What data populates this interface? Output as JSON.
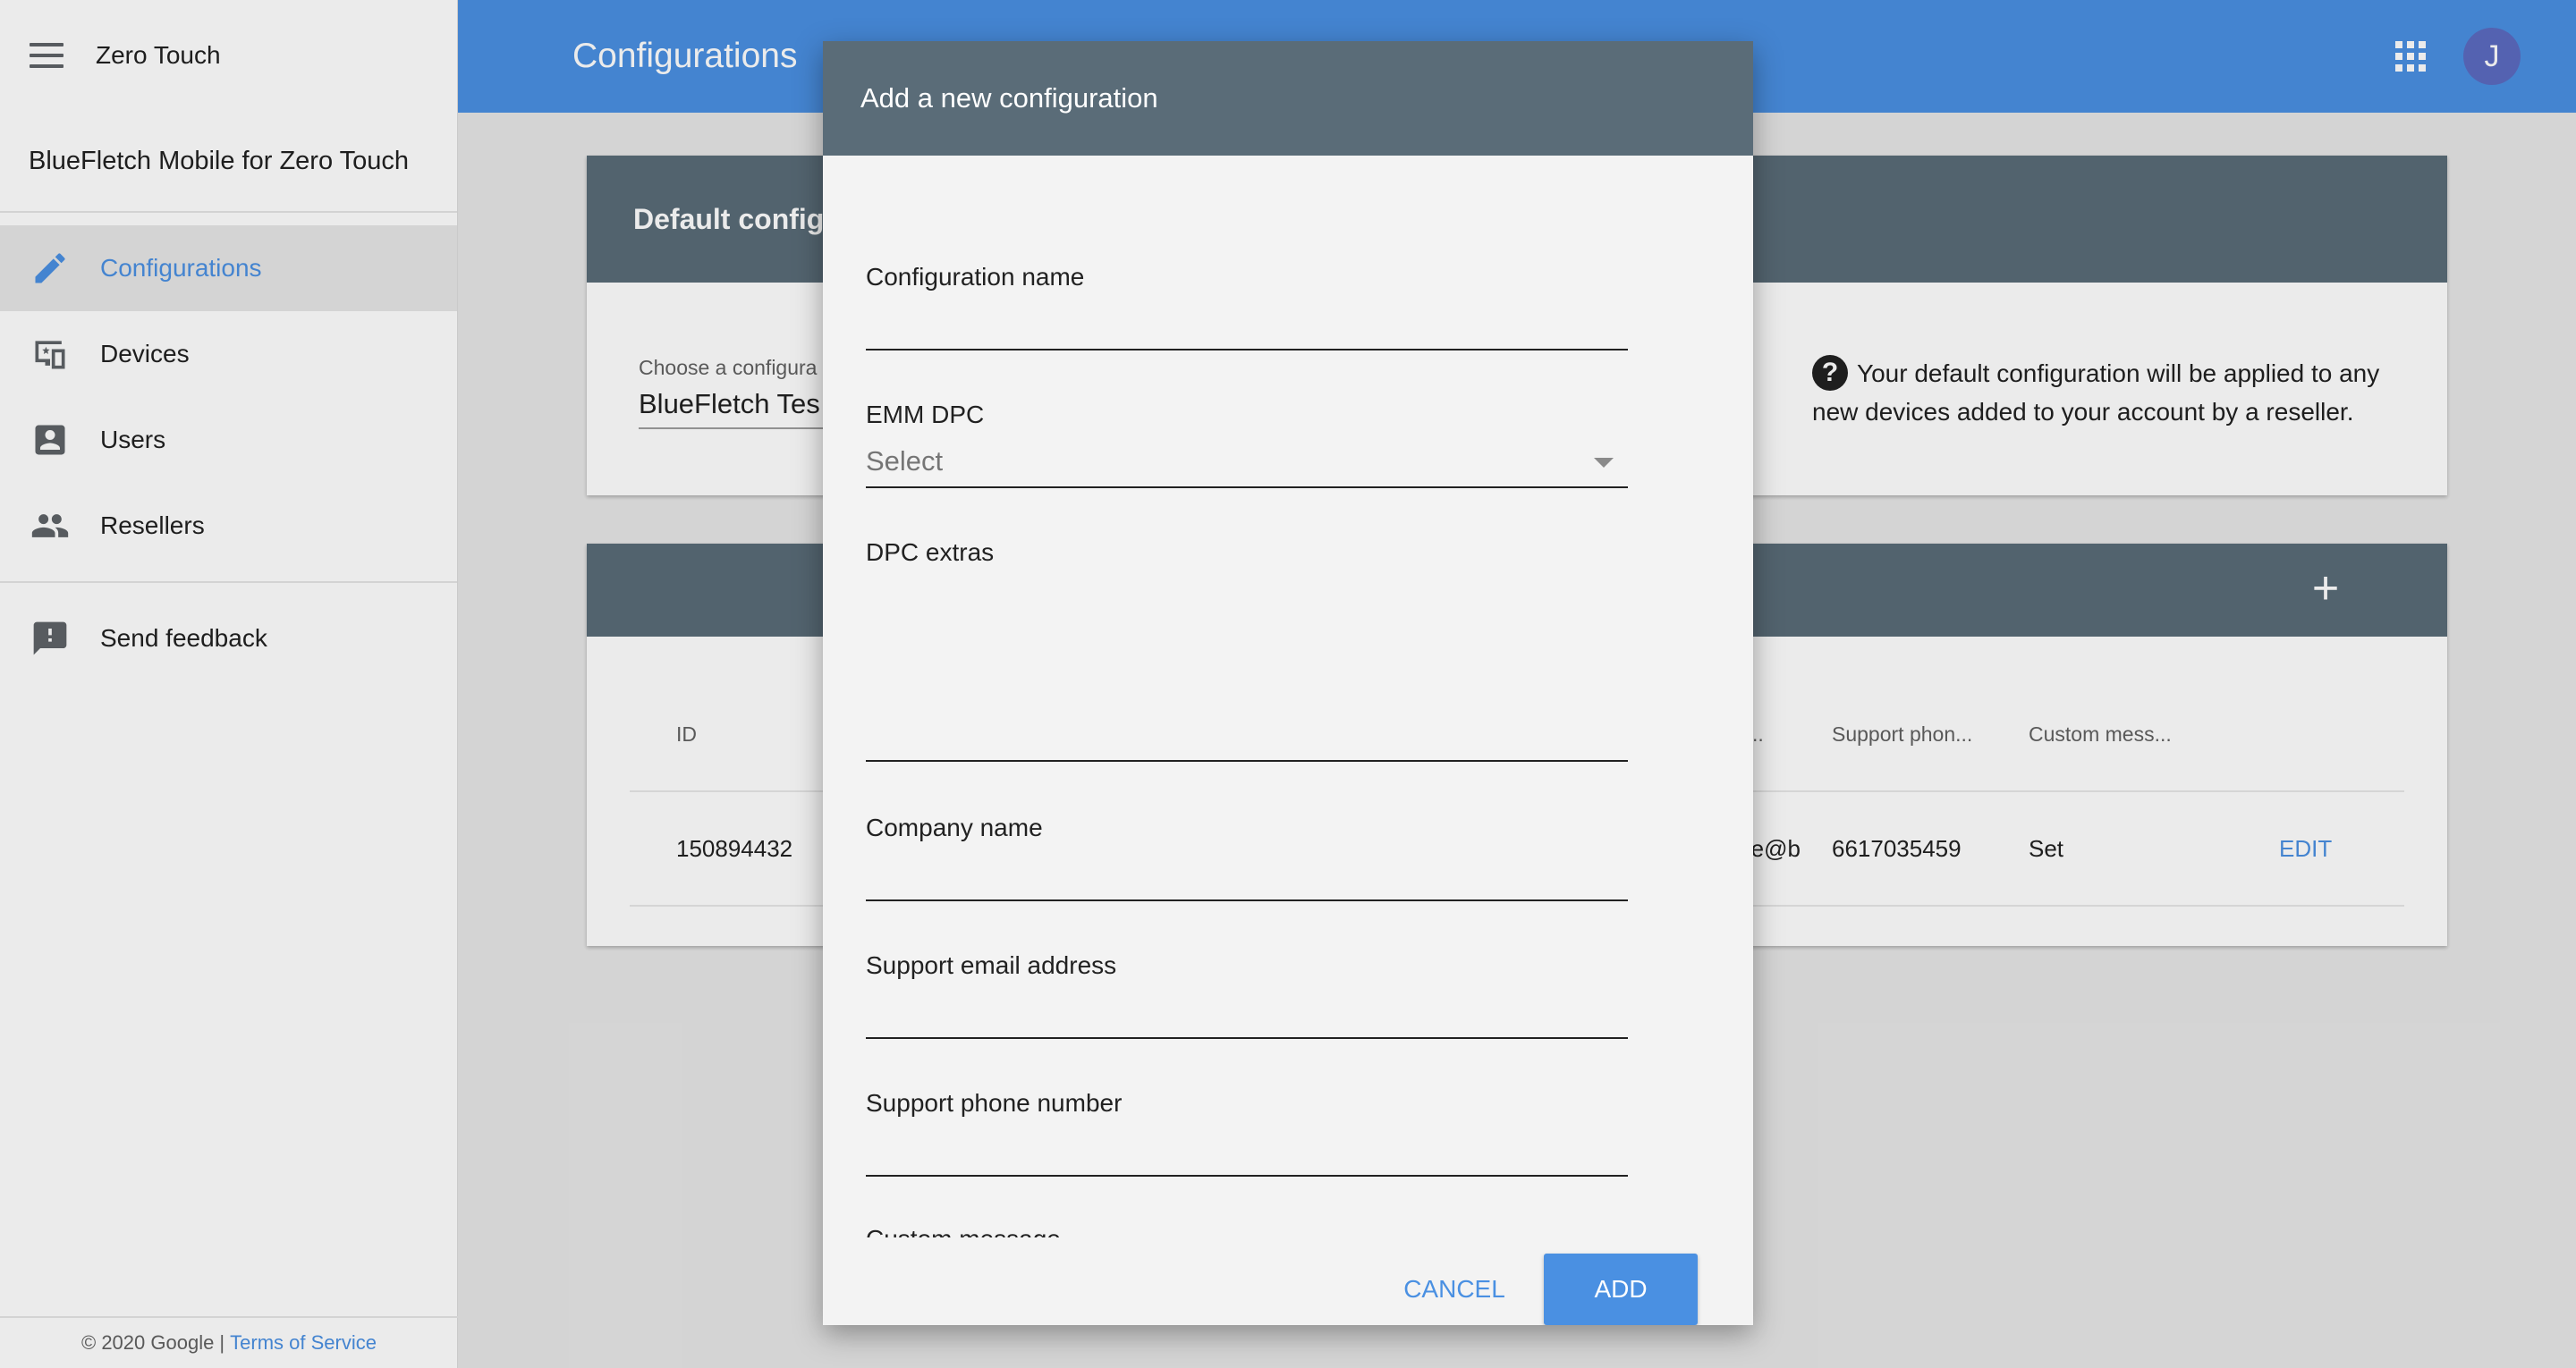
{
  "app": {
    "name": "Zero Touch",
    "subtitle": "BlueFletch Mobile for Zero Touch"
  },
  "sidebar": {
    "items": [
      {
        "label": "Configurations",
        "icon": "pencil-icon",
        "active": true
      },
      {
        "label": "Devices",
        "icon": "devices-icon",
        "active": false
      },
      {
        "label": "Users",
        "icon": "user-icon",
        "active": false
      },
      {
        "label": "Resellers",
        "icon": "people-icon",
        "active": false
      }
    ],
    "feedback": {
      "label": "Send feedback",
      "icon": "feedback-icon"
    },
    "footer": {
      "copyright": "© 2020 Google |",
      "terms": "Terms of Service"
    }
  },
  "appbar": {
    "title": "Configurations",
    "avatar_initial": "J"
  },
  "default_card": {
    "title": "Default configu",
    "choose_label": "Choose a configura",
    "choose_value": "BlueFletch Tes",
    "help_text": "Your default configuration will be applied to any new devices added to your account by a reseller."
  },
  "config_table": {
    "headers": {
      "id": "ID",
      "email": "il ...",
      "phone": "Support phon...",
      "custom": "Custom mess..."
    },
    "rows": [
      {
        "id": "150894432",
        "email": "rke@b",
        "phone": "6617035459",
        "custom": "Set",
        "action": "EDIT"
      }
    ]
  },
  "dialog": {
    "title": "Add a new configuration",
    "fields": {
      "config_name": {
        "label": "Configuration name",
        "value": ""
      },
      "emm_dpc": {
        "label": "EMM DPC",
        "value": "Select"
      },
      "dpc_extras": {
        "label": "DPC extras",
        "value": ""
      },
      "company_name": {
        "label": "Company name",
        "value": ""
      },
      "support_email": {
        "label": "Support email address",
        "value": ""
      },
      "support_phone": {
        "label": "Support phone number",
        "value": ""
      },
      "custom_message": {
        "label": "Custom message",
        "value": ""
      }
    },
    "cancel_label": "CANCEL",
    "add_label": "ADD"
  },
  "colors": {
    "primary": "#4a90e2",
    "header_slate": "#5a6c78",
    "avatar": "#5c6bc0"
  }
}
